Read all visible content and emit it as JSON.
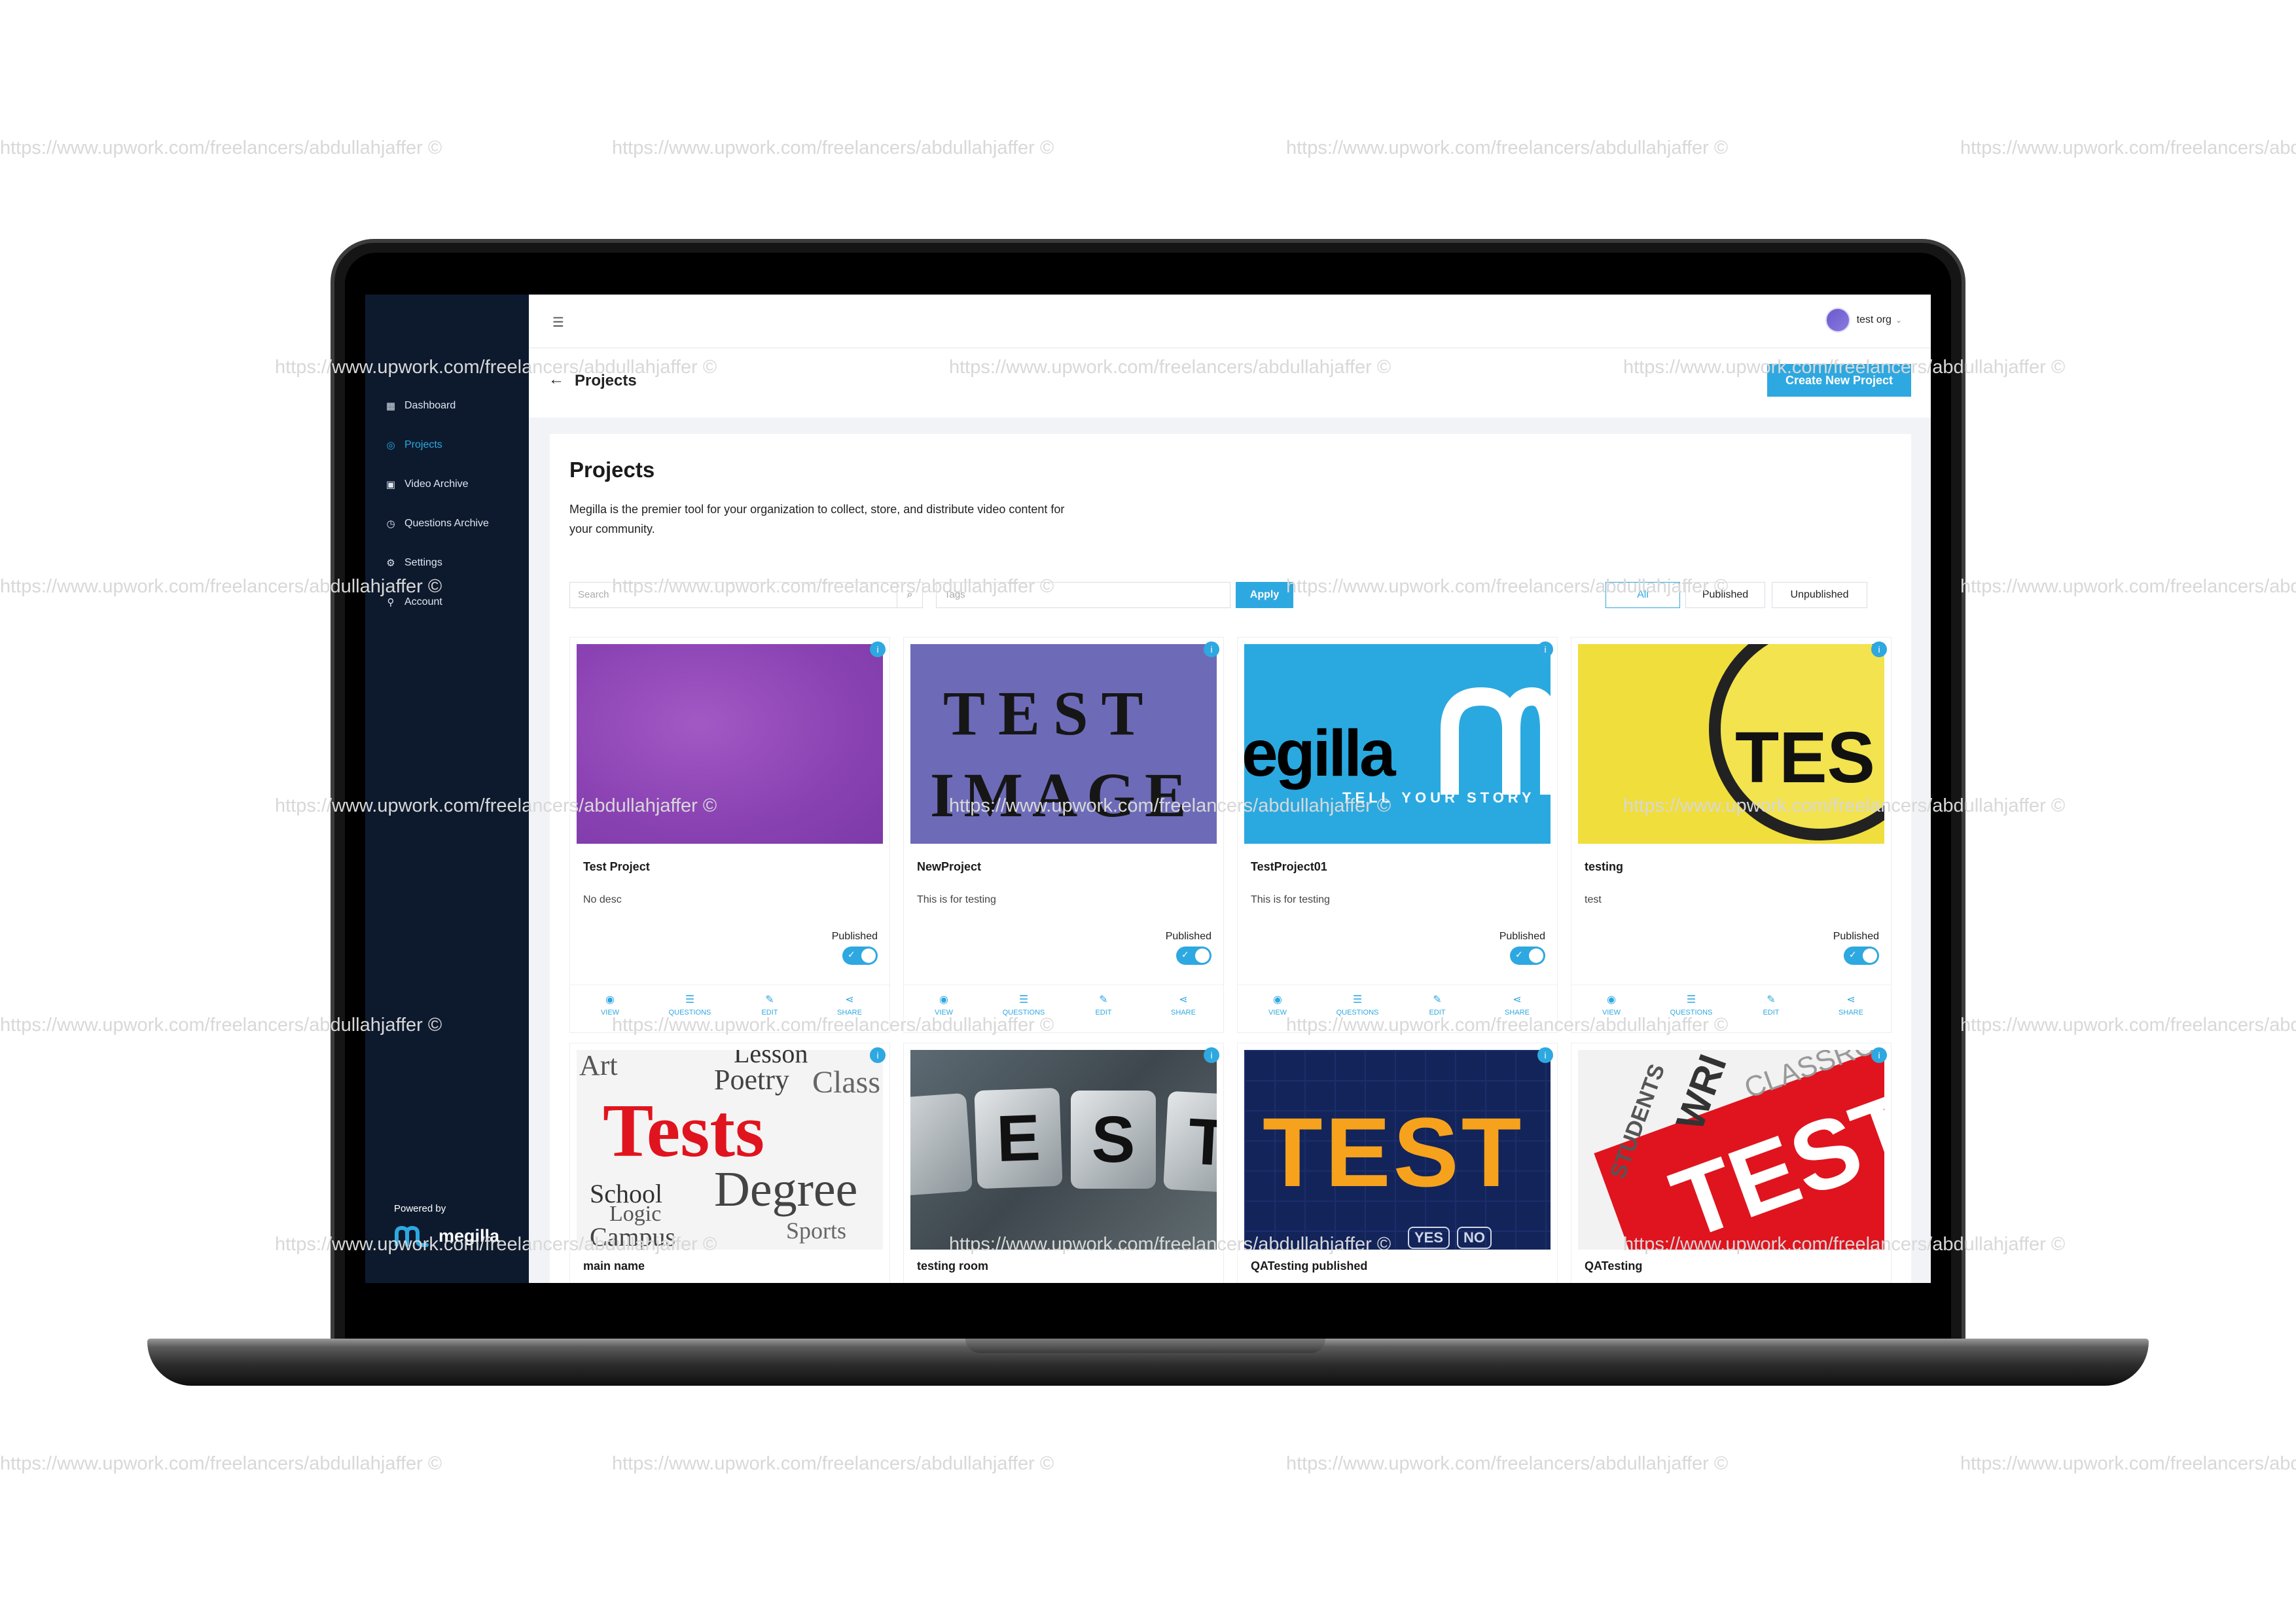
{
  "watermark": "https://www.upwork.com/freelancers/abdullahjaffer ©",
  "sidebar": {
    "items": [
      {
        "label": "Dashboard",
        "icon": "grid-icon"
      },
      {
        "label": "Projects",
        "icon": "compass-icon",
        "active": true
      },
      {
        "label": "Video Archive",
        "icon": "video-icon"
      },
      {
        "label": "Questions Archive",
        "icon": "clock-icon"
      },
      {
        "label": "Settings",
        "icon": "gear-icon"
      },
      {
        "label": "Account",
        "icon": "user-icon"
      }
    ],
    "powered_by": "Powered by",
    "brand": "megilla"
  },
  "topbar": {
    "menu_icon": "hamburger-icon",
    "org": "test org"
  },
  "header": {
    "title": "Projects",
    "create_button": "Create New Project"
  },
  "main": {
    "title": "Projects",
    "description": "Megilla is the premier tool for your organization to collect, store, and distribute video content for your community.",
    "search_placeholder": "Search",
    "tags_placeholder": "Tags",
    "apply": "Apply",
    "filters": [
      "All",
      "Published",
      "Unpublished"
    ]
  },
  "card_actions": [
    "VIEW",
    "QUESTIONS",
    "EDIT",
    "SHARE"
  ],
  "projects": [
    {
      "title": "Test Project",
      "desc": "No desc",
      "status": "Published",
      "thumb": "purple"
    },
    {
      "title": "NewProject",
      "desc": "This is for testing",
      "status": "Published",
      "thumb": "test-image",
      "thumb_text": [
        "TEST",
        "IMAGE"
      ]
    },
    {
      "title": "TestProject01",
      "desc": "This is for testing",
      "status": "Published",
      "thumb": "megilla",
      "thumb_text": [
        "egilla",
        "TELL YOUR STORY"
      ]
    },
    {
      "title": "testing",
      "desc": "test",
      "status": "Published",
      "thumb": "yellow",
      "thumb_text": [
        "TES"
      ]
    },
    {
      "title": "main name",
      "thumb": "tests-words",
      "thumb_text": [
        "Tests",
        "Degree",
        "School",
        "Campus",
        "Poetry",
        "Class",
        "Lesson",
        "Sports",
        "Logic",
        "Art"
      ]
    },
    {
      "title": "testing room",
      "thumb": "cubes",
      "thumb_text": [
        "E",
        "S",
        "T"
      ]
    },
    {
      "title": "QATesting published",
      "thumb": "navy-test",
      "thumb_text": [
        "TEST",
        "YES",
        "NO"
      ]
    },
    {
      "title": "QATesting",
      "thumb": "red-test",
      "thumb_text": [
        "TEST",
        "STUDENTS",
        "WRI",
        "CLASSRO"
      ]
    }
  ]
}
